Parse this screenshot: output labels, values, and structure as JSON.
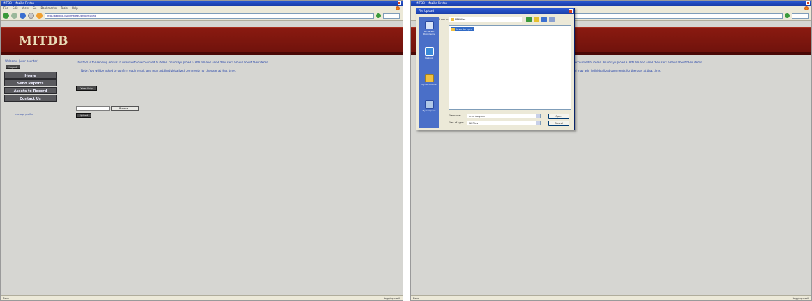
{
  "left": {
    "window_title": "MITDB - Mozilla Firefox",
    "menu": [
      "File",
      "Edit",
      "View",
      "Go",
      "Bookmarks",
      "Tools",
      "Help"
    ],
    "url": "http://tagging.csail.mit.edu/property.php",
    "logo": "MITDB",
    "welcome": "Welcome (user counter)",
    "logout": "Logout",
    "sidebar": {
      "items": [
        {
          "label": "Home"
        },
        {
          "label": "Send Reports"
        },
        {
          "label": "Assets to Record"
        },
        {
          "label": "Contact Us"
        }
      ],
      "link": "manage profile"
    },
    "info_line1": "This tool is for sending emails to users with overcounted hi items. You may upload a PRN file and send the users emails about their items.",
    "info_line2": "Note: You will be asked to confirm each email, and may add individualized comments for the user at that time.",
    "view_help_label": "View Help",
    "browse_label": "Browse...",
    "upload_label": "Upload",
    "status_left": "Done",
    "status_right": "tagging.csail"
  },
  "right": {
    "window_title": "MITDB - Mozilla Firefox",
    "dialog": {
      "title": "File Upload",
      "look_in_label": "Look in:",
      "look_in_value": "PRN files",
      "places": [
        {
          "label": "My Recent Documents",
          "icon": "recent-documents-icon"
        },
        {
          "label": "Desktop",
          "icon": "desktop-icon"
        },
        {
          "label": "My Documents",
          "icon": "my-documents-icon"
        },
        {
          "label": "My Computer",
          "icon": "my-computer-icon"
        }
      ],
      "selected_file": "inventory.prn",
      "file_name_label": "File name:",
      "file_name_value": "inventory.prn",
      "file_type_label": "Files of type:",
      "file_type_value": "All Files",
      "open_label": "Open",
      "cancel_label": "Cancel"
    },
    "info_line1": "overcounted hi items. You may upload a PRN file and send the users emails about their items.",
    "info_line2": "and may add individualized comments for the user at that time.",
    "status_left": "Done",
    "status_right": "tagging.csail"
  }
}
